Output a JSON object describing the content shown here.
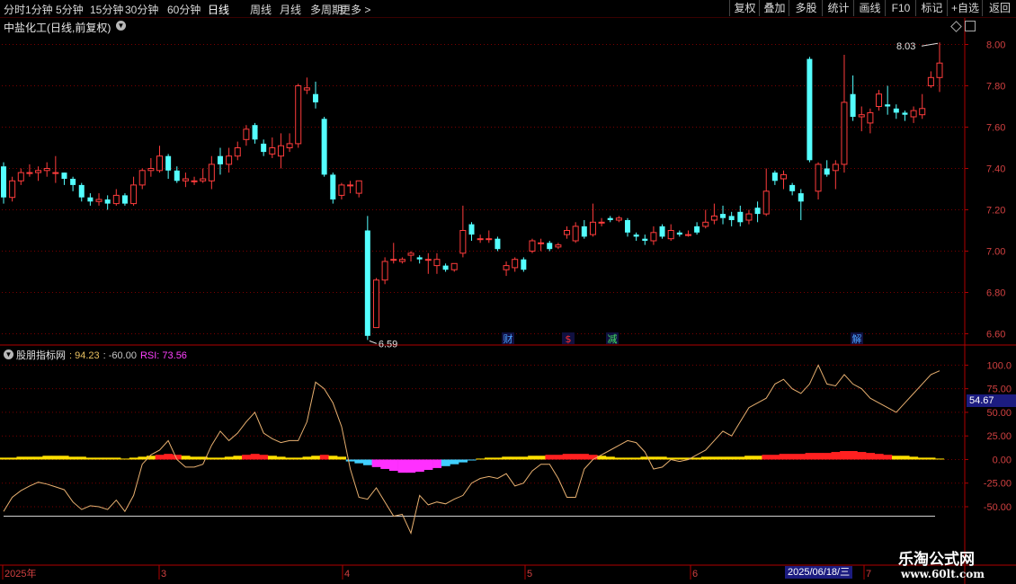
{
  "toolbar": {
    "periods": [
      {
        "label": "分时",
        "active": false
      },
      {
        "label": "1分钟",
        "active": false
      },
      {
        "label": "5分钟",
        "active": false
      },
      {
        "label": "15分钟",
        "active": false
      },
      {
        "label": "30分钟",
        "active": false
      },
      {
        "label": "60分钟",
        "active": false
      },
      {
        "label": "日线",
        "active": true
      },
      {
        "label": "周线",
        "active": false
      },
      {
        "label": "月线",
        "active": false
      },
      {
        "label": "多周期",
        "active": false
      },
      {
        "label": "更多 >",
        "active": false
      }
    ],
    "right_buttons": [
      "复权",
      "叠加",
      "多股",
      "统计",
      "画线",
      "F10",
      "标记",
      "+自选",
      "返回"
    ]
  },
  "chart_title": "中盐化工(日线,前复权)",
  "indicator_title": {
    "name": "股朋指标网",
    "v1": ": 94.23",
    "v2": ": -60.00",
    "rsi": "RSI: 73.56"
  },
  "price_axis_ticks": [
    "8.00",
    "7.80",
    "7.60",
    "7.40",
    "7.20",
    "7.00",
    "6.80",
    "6.60"
  ],
  "indicator_axis_ticks": [
    "100.0",
    "75.00",
    "50.00",
    "25.00",
    "0.00",
    "-25.00",
    "-50.00"
  ],
  "indicator_current_value": "54.67",
  "price_annotations": {
    "high": "8.03",
    "low": "6.59"
  },
  "event_markers": [
    {
      "text": "财",
      "color": "#4aa0ff"
    },
    {
      "text": "$",
      "color": "#ff3030"
    },
    {
      "text": "减",
      "color": "#40e060"
    },
    {
      "text": "解",
      "color": "#4aa0ff"
    }
  ],
  "date_axis": {
    "labels": [
      "2025年",
      "3",
      "4",
      "5",
      "6",
      "7"
    ],
    "highlight": "2025/06/18/三"
  },
  "watermark": {
    "main": "乐淘公式网",
    "url": "www.60lt.com"
  },
  "colors": {
    "up": "#ff3c3c",
    "down": "#54ffff",
    "grid": "#7a0000",
    "axis": "#b00000"
  },
  "chart_data": {
    "type": "candlestick",
    "title": "中盐化工(日线,前复权)",
    "ylim": [
      6.55,
      8.05
    ],
    "candles": [
      [
        7.41,
        7.26,
        7.43,
        7.23
      ],
      [
        7.26,
        7.34,
        7.36,
        7.24
      ],
      [
        7.34,
        7.38,
        7.4,
        7.32
      ],
      [
        7.38,
        7.38,
        7.42,
        7.36
      ],
      [
        7.38,
        7.39,
        7.41,
        7.34
      ],
      [
        7.39,
        7.4,
        7.43,
        7.36
      ],
      [
        7.38,
        7.38,
        7.46,
        7.33
      ],
      [
        7.38,
        7.35,
        7.38,
        7.32
      ],
      [
        7.35,
        7.32,
        7.36,
        7.29
      ],
      [
        7.32,
        7.26,
        7.33,
        7.24
      ],
      [
        7.26,
        7.24,
        7.28,
        7.22
      ],
      [
        7.24,
        7.25,
        7.28,
        7.22
      ],
      [
        7.25,
        7.23,
        7.27,
        7.2
      ],
      [
        7.23,
        7.27,
        7.3,
        7.22
      ],
      [
        7.27,
        7.23,
        7.28,
        7.22
      ],
      [
        7.23,
        7.32,
        7.36,
        7.22
      ],
      [
        7.32,
        7.39,
        7.4,
        7.3
      ],
      [
        7.39,
        7.4,
        7.45,
        7.36
      ],
      [
        7.39,
        7.46,
        7.51,
        7.38
      ],
      [
        7.46,
        7.39,
        7.47,
        7.35
      ],
      [
        7.39,
        7.34,
        7.41,
        7.33
      ],
      [
        7.34,
        7.35,
        7.38,
        7.31
      ],
      [
        7.34,
        7.34,
        7.36,
        7.32
      ],
      [
        7.34,
        7.35,
        7.4,
        7.33
      ],
      [
        7.34,
        7.42,
        7.46,
        7.3
      ],
      [
        7.46,
        7.42,
        7.5,
        7.37
      ],
      [
        7.42,
        7.46,
        7.5,
        7.38
      ],
      [
        7.46,
        7.5,
        7.53,
        7.44
      ],
      [
        7.54,
        7.59,
        7.61,
        7.51
      ],
      [
        7.61,
        7.54,
        7.62,
        7.52
      ],
      [
        7.52,
        7.48,
        7.54,
        7.46
      ],
      [
        7.47,
        7.5,
        7.55,
        7.45
      ],
      [
        7.46,
        7.51,
        7.57,
        7.4
      ],
      [
        7.5,
        7.52,
        7.57,
        7.48
      ],
      [
        7.52,
        7.8,
        7.81,
        7.5
      ],
      [
        7.78,
        7.79,
        7.84,
        7.76
      ],
      [
        7.76,
        7.72,
        7.82,
        7.69
      ],
      [
        7.64,
        7.37,
        7.65,
        7.36
      ],
      [
        7.37,
        7.25,
        7.38,
        7.23
      ],
      [
        7.27,
        7.32,
        7.33,
        7.25
      ],
      [
        7.32,
        7.32,
        7.34,
        7.28
      ],
      [
        7.28,
        7.34,
        7.34,
        7.26
      ],
      [
        7.1,
        6.59,
        7.17,
        6.57
      ],
      [
        6.63,
        6.86,
        6.87,
        6.63
      ],
      [
        6.86,
        6.95,
        6.97,
        6.84
      ],
      [
        6.96,
        6.96,
        7.04,
        6.94
      ],
      [
        6.95,
        6.96,
        6.97,
        6.94
      ],
      [
        6.98,
        6.99,
        7.0,
        6.95
      ],
      [
        6.97,
        6.96,
        6.98,
        6.94
      ],
      [
        6.96,
        6.96,
        6.99,
        6.89
      ],
      [
        6.93,
        6.96,
        6.99,
        6.89
      ],
      [
        6.93,
        6.91,
        6.94,
        6.9
      ],
      [
        6.91,
        6.94,
        6.94,
        6.9
      ],
      [
        6.99,
        7.1,
        7.22,
        6.97
      ],
      [
        7.13,
        7.08,
        7.14,
        7.05
      ],
      [
        7.06,
        7.06,
        7.08,
        7.04
      ],
      [
        7.06,
        7.06,
        7.1,
        7.04
      ],
      [
        7.06,
        7.01,
        7.07,
        7.0
      ],
      [
        6.91,
        6.93,
        6.95,
        6.88
      ],
      [
        6.92,
        6.96,
        6.97,
        6.9
      ],
      [
        6.96,
        6.91,
        6.97,
        6.9
      ],
      [
        7.0,
        7.05,
        7.06,
        6.99
      ],
      [
        7.04,
        7.04,
        7.06,
        7.0
      ],
      [
        7.04,
        7.01,
        7.05,
        7.0
      ],
      [
        7.02,
        7.03,
        7.04,
        7.01
      ],
      [
        7.08,
        7.1,
        7.12,
        7.06
      ],
      [
        7.05,
        7.12,
        7.14,
        7.04
      ],
      [
        7.12,
        7.07,
        7.15,
        7.06
      ],
      [
        7.08,
        7.14,
        7.23,
        7.07
      ],
      [
        7.14,
        7.14,
        7.16,
        7.12
      ],
      [
        7.16,
        7.15,
        7.17,
        7.14
      ],
      [
        7.15,
        7.16,
        7.17,
        7.14
      ],
      [
        7.15,
        7.09,
        7.16,
        7.07
      ],
      [
        7.08,
        7.07,
        7.09,
        7.05
      ],
      [
        7.06,
        7.05,
        7.08,
        7.03
      ],
      [
        7.05,
        7.09,
        7.12,
        7.03
      ],
      [
        7.12,
        7.07,
        7.13,
        7.06
      ],
      [
        7.06,
        7.1,
        7.13,
        7.05
      ],
      [
        7.09,
        7.08,
        7.1,
        7.07
      ],
      [
        7.08,
        7.08,
        7.1,
        7.07
      ],
      [
        7.12,
        7.09,
        7.14,
        7.08
      ],
      [
        7.12,
        7.14,
        7.2,
        7.11
      ],
      [
        7.15,
        7.17,
        7.23,
        7.13
      ],
      [
        7.18,
        7.16,
        7.22,
        7.13
      ],
      [
        7.17,
        7.15,
        7.19,
        7.12
      ],
      [
        7.19,
        7.14,
        7.22,
        7.12
      ],
      [
        7.15,
        7.18,
        7.2,
        7.13
      ],
      [
        7.21,
        7.18,
        7.24,
        7.14
      ],
      [
        7.18,
        7.29,
        7.4,
        7.17
      ],
      [
        7.38,
        7.34,
        7.39,
        7.32
      ],
      [
        7.35,
        7.37,
        7.39,
        7.3
      ],
      [
        7.32,
        7.29,
        7.33,
        7.27
      ],
      [
        7.28,
        7.24,
        7.3,
        7.15
      ],
      [
        7.93,
        7.44,
        7.94,
        7.43
      ],
      [
        7.29,
        7.42,
        7.43,
        7.25
      ],
      [
        7.4,
        7.37,
        7.44,
        7.36
      ],
      [
        7.39,
        7.42,
        7.44,
        7.3
      ],
      [
        7.42,
        7.72,
        7.95,
        7.38
      ],
      [
        7.76,
        7.65,
        7.85,
        7.63
      ],
      [
        7.65,
        7.66,
        7.7,
        7.58
      ],
      [
        7.62,
        7.67,
        7.69,
        7.57
      ],
      [
        7.7,
        7.76,
        7.78,
        7.68
      ],
      [
        7.71,
        7.7,
        7.8,
        7.66
      ],
      [
        7.69,
        7.67,
        7.71,
        7.64
      ],
      [
        7.67,
        7.66,
        7.68,
        7.63
      ],
      [
        7.65,
        7.68,
        7.7,
        7.62
      ],
      [
        7.66,
        7.69,
        7.76,
        7.64
      ],
      [
        7.8,
        7.84,
        7.87,
        7.79
      ],
      [
        7.84,
        7.91,
        8.01,
        7.77
      ]
    ],
    "indicator_line": [
      -55,
      -40,
      -33,
      -28,
      -24,
      -26,
      -29,
      -32,
      -45,
      -53,
      -49,
      -50,
      -53,
      -43,
      -55,
      -38,
      -5,
      5,
      10,
      20,
      0,
      -8,
      -8,
      -5,
      15,
      30,
      20,
      28,
      40,
      50,
      28,
      22,
      18,
      20,
      20,
      40,
      82,
      75,
      60,
      35,
      -10,
      -40,
      -42,
      -30,
      -45,
      -60,
      -58,
      -78,
      -38,
      -48,
      -45,
      -47,
      -42,
      -38,
      -25,
      -20,
      -18,
      -20,
      -15,
      -28,
      -25,
      -12,
      -5,
      -5,
      -20,
      -40,
      -40,
      -10,
      0,
      5,
      10,
      15,
      20,
      18,
      8,
      -10,
      -8,
      0,
      -2,
      0,
      5,
      10,
      20,
      30,
      25,
      40,
      55,
      60,
      65,
      80,
      85,
      75,
      70,
      80,
      100,
      80,
      78,
      90,
      80,
      75,
      65,
      60,
      55,
      50,
      60,
      70,
      80,
      90,
      94
    ],
    "baseline": -60,
    "histogram": [
      2,
      2,
      3,
      3,
      3,
      4,
      4,
      4,
      3,
      3,
      2,
      2,
      2,
      2,
      1,
      2,
      3,
      4,
      5,
      6,
      5,
      4,
      3,
      3,
      2,
      2,
      3,
      4,
      5,
      6,
      5,
      4,
      3,
      2,
      2,
      3,
      4,
      5,
      4,
      3,
      -2,
      -4,
      -6,
      -8,
      -10,
      -12,
      -14,
      -14,
      -13,
      -11,
      -9,
      -7,
      -5,
      -3,
      -1,
      1,
      2,
      2,
      3,
      3,
      3,
      4,
      4,
      5,
      5,
      6,
      6,
      6,
      5,
      4,
      3,
      2,
      2,
      2,
      3,
      3,
      3,
      2,
      2,
      2,
      2,
      3,
      3,
      3,
      3,
      3,
      4,
      4,
      5,
      5,
      6,
      6,
      6,
      7,
      7,
      7,
      8,
      9,
      9,
      8,
      7,
      6,
      5,
      4,
      4,
      3,
      2,
      2,
      1
    ],
    "ind_ylim": [
      -70,
      108
    ]
  }
}
